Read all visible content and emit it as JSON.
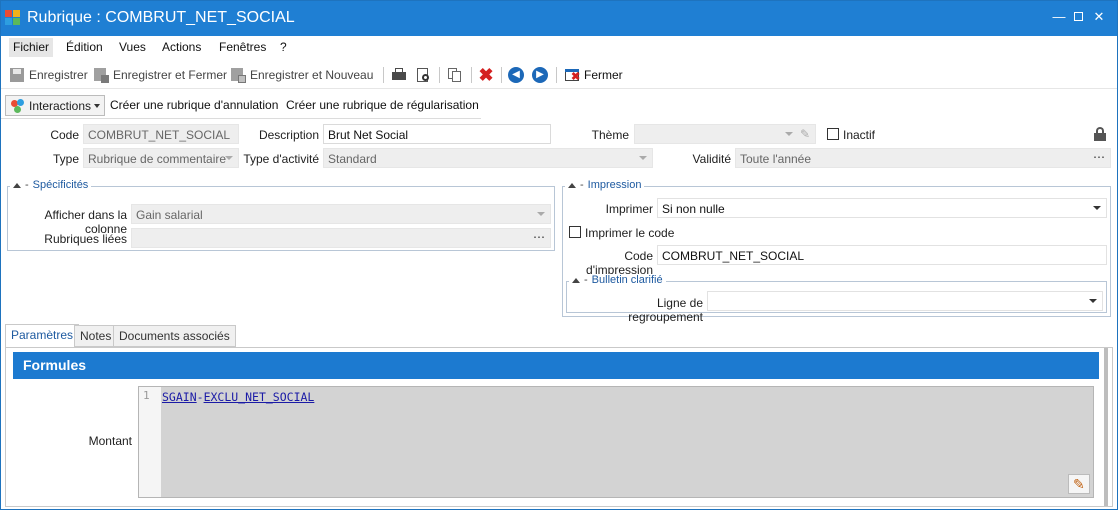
{
  "window": {
    "title": "Rubrique : COMBRUT_NET_SOCIAL"
  },
  "menu": [
    "Fichier",
    "Édition",
    "Vues",
    "Actions",
    "Fenêtres",
    "?"
  ],
  "toolbar": {
    "save": "Enregistrer",
    "save_close": "Enregistrer et Fermer",
    "save_new": "Enregistrer et Nouveau",
    "close": "Fermer"
  },
  "actions": {
    "interactions": "Interactions",
    "cancel_rubric": "Créer une rubrique d'annulation",
    "regul_rubric": "Créer une rubrique de régularisation"
  },
  "form": {
    "code_label": "Code",
    "code_value": "COMBRUT_NET_SOCIAL",
    "description_label": "Description",
    "description_value": "Brut Net Social",
    "theme_label": "Thème",
    "theme_value": "",
    "inactif_label": "Inactif",
    "type_label": "Type",
    "type_value": "Rubrique de commentaire",
    "activity_label": "Type d'activité",
    "activity_value": "Standard",
    "validity_label": "Validité",
    "validity_value": "Toute l'année"
  },
  "specificites": {
    "title": "Spécificités",
    "column_label": "Afficher dans la colonne",
    "column_value": "Gain salarial",
    "linked_label": "Rubriques liées",
    "linked_value": ""
  },
  "impression": {
    "title": "Impression",
    "print_label": "Imprimer",
    "print_value": "Si non nulle",
    "print_code_label": "Imprimer le code",
    "code_label": "Code d'impression",
    "code_value": "COMBRUT_NET_SOCIAL",
    "bulletin_title": "Bulletin clarifié",
    "group_line_label": "Ligne de regroupement",
    "group_line_value": ""
  },
  "tabs": [
    "Paramètres",
    "Notes",
    "Documents associés"
  ],
  "formules": {
    "header": "Formules",
    "montant_label": "Montant",
    "line_number": "1",
    "code_part1": "SGAIN",
    "code_op": "-",
    "code_part2": "EXCLU_NET_SOCIAL"
  },
  "colors": {
    "titlebar": "#1f7fd3",
    "accent": "#1c7ad0",
    "delete": "#d42020"
  }
}
